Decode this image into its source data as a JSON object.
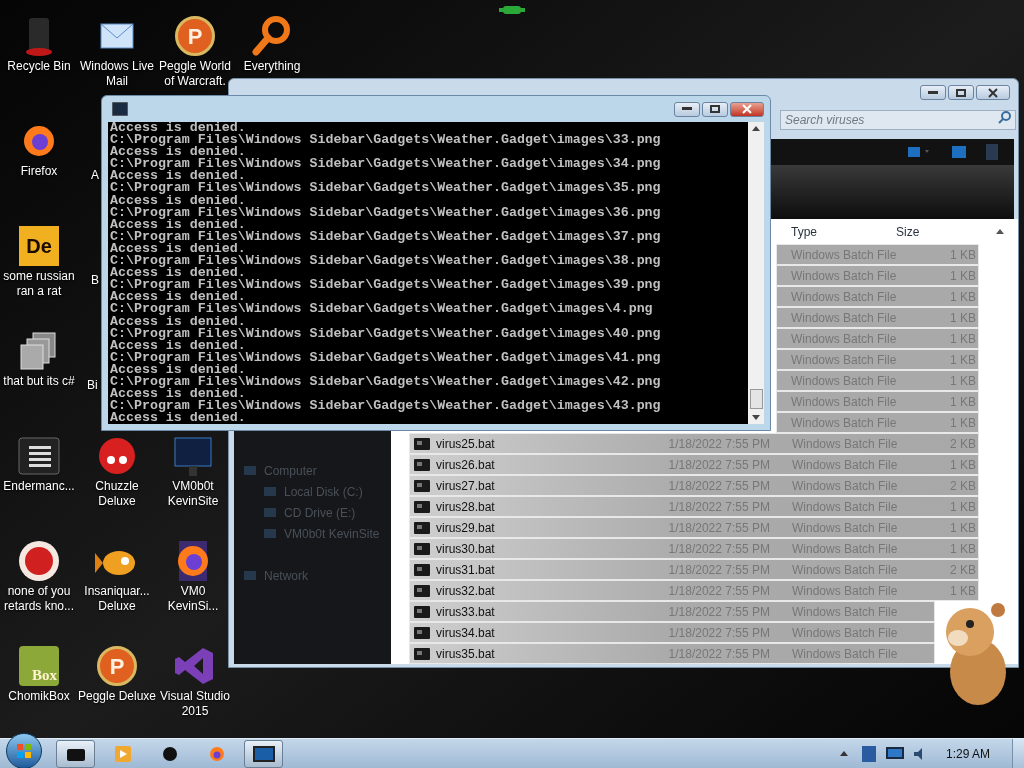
{
  "desktop_icons": [
    {
      "label": "Recycle Bin"
    },
    {
      "label": "Firefox"
    },
    {
      "label": "some russian ran a rat",
      "logo_text": "De"
    },
    {
      "label": "that but its c#"
    },
    {
      "label": "Endermanc..."
    },
    {
      "label": "none of you retards kno..."
    },
    {
      "label": "ChomikBox",
      "logo_text": "Box"
    },
    {
      "label": "Windows Live Mail"
    },
    {
      "label": "A"
    },
    {
      "label": "B"
    },
    {
      "label": "Bi"
    },
    {
      "label": "Chuzzle Deluxe"
    },
    {
      "label": "Insaniquar... Deluxe"
    },
    {
      "label": "Peggle Deluxe",
      "logo_text": "P"
    },
    {
      "label": "Peggle World of Warcraft.",
      "logo_text": "P"
    },
    {
      "label": "VM0b0t KevinSite"
    },
    {
      "label": "VM0 KevinSi..."
    },
    {
      "label": "Visual Studio 2015"
    },
    {
      "label": "Everything"
    }
  ],
  "explorer": {
    "search": {
      "placeholder": "Search viruses"
    },
    "columns": [
      "Type",
      "Size"
    ],
    "navigation": [
      {
        "label": "Computer",
        "children": [
          {
            "label": "Local Disk (C:)"
          },
          {
            "label": "CD Drive (E:)"
          },
          {
            "label": "VM0b0t KevinSite"
          }
        ]
      },
      {
        "label": "Network"
      }
    ],
    "rows": [
      {
        "type": "Windows Batch File",
        "size": "1 KB"
      },
      {
        "type": "Windows Batch File",
        "size": "1 KB"
      },
      {
        "type": "Windows Batch File",
        "size": "1 KB"
      },
      {
        "type": "Windows Batch File",
        "size": "1 KB"
      },
      {
        "type": "Windows Batch File",
        "size": "1 KB"
      },
      {
        "type": "Windows Batch File",
        "size": "1 KB"
      },
      {
        "type": "Windows Batch File",
        "size": "1 KB"
      },
      {
        "type": "Windows Batch File",
        "size": "1 KB"
      },
      {
        "type": "Windows Batch File",
        "size": "1 KB"
      },
      {
        "name": "virus25.bat",
        "date": "1/18/2022 7:55 PM",
        "type": "Windows Batch File",
        "size": "2 KB"
      },
      {
        "name": "virus26.bat",
        "date": "1/18/2022 7:55 PM",
        "type": "Windows Batch File",
        "size": "1 KB"
      },
      {
        "name": "virus27.bat",
        "date": "1/18/2022 7:55 PM",
        "type": "Windows Batch File",
        "size": "2 KB"
      },
      {
        "name": "virus28.bat",
        "date": "1/18/2022 7:55 PM",
        "type": "Windows Batch File",
        "size": "1 KB"
      },
      {
        "name": "virus29.bat",
        "date": "1/18/2022 7:55 PM",
        "type": "Windows Batch File",
        "size": "1 KB"
      },
      {
        "name": "virus30.bat",
        "date": "1/18/2022 7:55 PM",
        "type": "Windows Batch File",
        "size": "1 KB"
      },
      {
        "name": "virus31.bat",
        "date": "1/18/2022 7:55 PM",
        "type": "Windows Batch File",
        "size": "2 KB"
      },
      {
        "name": "virus32.bat",
        "date": "1/18/2022 7:55 PM",
        "type": "Windows Batch File",
        "size": "1 KB"
      },
      {
        "name": "virus33.bat",
        "date": "1/18/2022 7:55 PM",
        "type": "Windows Batch File"
      },
      {
        "name": "virus34.bat",
        "date": "1/18/2022 7:55 PM",
        "type": "Windows Batch File"
      },
      {
        "name": "virus35.bat",
        "date": "1/18/2022 7:55 PM",
        "type": "Windows Batch File"
      }
    ]
  },
  "console": {
    "lines": [
      "Access is denied.",
      "C:\\Program Files\\Windows Sidebar\\Gadgets\\Weather.Gadget\\images\\33.png",
      "Access is denied.",
      "C:\\Program Files\\Windows Sidebar\\Gadgets\\Weather.Gadget\\images\\34.png",
      "Access is denied.",
      "C:\\Program Files\\Windows Sidebar\\Gadgets\\Weather.Gadget\\images\\35.png",
      "Access is denied.",
      "C:\\Program Files\\Windows Sidebar\\Gadgets\\Weather.Gadget\\images\\36.png",
      "Access is denied.",
      "C:\\Program Files\\Windows Sidebar\\Gadgets\\Weather.Gadget\\images\\37.png",
      "Access is denied.",
      "C:\\Program Files\\Windows Sidebar\\Gadgets\\Weather.Gadget\\images\\38.png",
      "Access is denied.",
      "C:\\Program Files\\Windows Sidebar\\Gadgets\\Weather.Gadget\\images\\39.png",
      "Access is denied.",
      "C:\\Program Files\\Windows Sidebar\\Gadgets\\Weather.Gadget\\images\\4.png",
      "Access is denied.",
      "C:\\Program Files\\Windows Sidebar\\Gadgets\\Weather.Gadget\\images\\40.png",
      "Access is denied.",
      "C:\\Program Files\\Windows Sidebar\\Gadgets\\Weather.Gadget\\images\\41.png",
      "Access is denied.",
      "C:\\Program Files\\Windows Sidebar\\Gadgets\\Weather.Gadget\\images\\42.png",
      "Access is denied.",
      "C:\\Program Files\\Windows Sidebar\\Gadgets\\Weather.Gadget\\images\\43.png",
      "Access is denied."
    ]
  },
  "taskbar": {
    "buttons": [
      {
        "active": true
      },
      {
        "active": false
      },
      {
        "active": false
      },
      {
        "active": false
      },
      {
        "active": true
      }
    ],
    "clock": "1:29 AM"
  }
}
